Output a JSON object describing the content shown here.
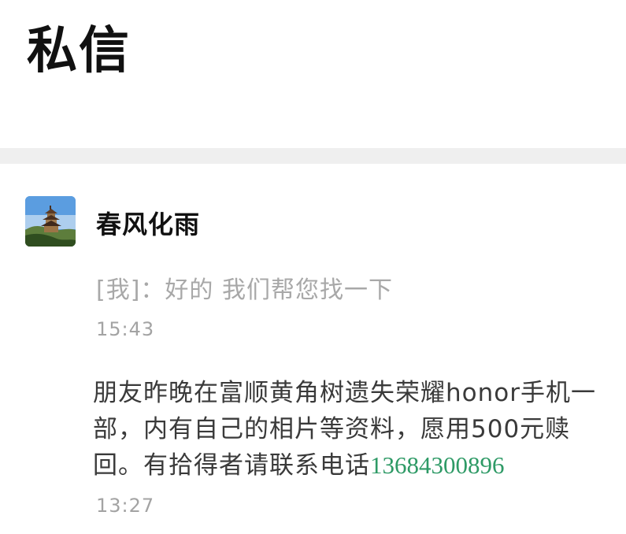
{
  "header": {
    "title": "私信"
  },
  "conversation": {
    "sender": "春风化雨",
    "avatar_icon": "pavilion-photo-avatar",
    "last_reply": "[我]：好的 我们帮您找一下",
    "last_reply_time": "15:43",
    "message_text": "朋友昨晚在富顺黄角树遗失荣耀honor手机一部，内有自己的相片等资料，愿用500元赎回。有拾得者请联系电话",
    "phone_number": "13684300896",
    "message_time": "13:27"
  },
  "colors": {
    "background": "#ffffff",
    "divider": "#efefef",
    "link": "#2e9a66",
    "muted_text": "#a8a8a8"
  }
}
